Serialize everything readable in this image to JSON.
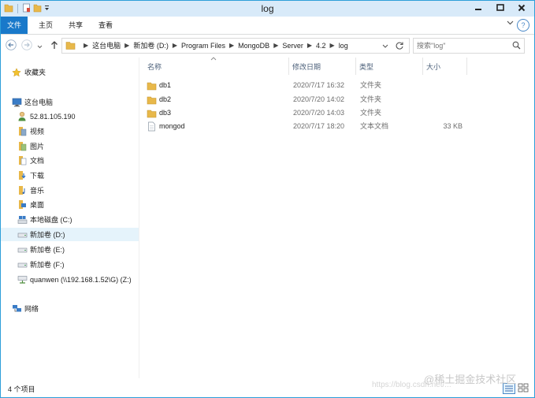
{
  "window": {
    "title": "log"
  },
  "quick_access": {
    "icons": [
      "folder-icon",
      "properties-icon",
      "new-folder-icon",
      "dropdown-icon"
    ]
  },
  "ribbon": {
    "tabs": [
      {
        "label": "文件",
        "active": true
      },
      {
        "label": "主页"
      },
      {
        "label": "共享"
      },
      {
        "label": "查看"
      }
    ],
    "help": "?"
  },
  "nav": {
    "back": "←",
    "forward": "→",
    "up": "↑"
  },
  "address": {
    "crumbs": [
      "这台电脑",
      "新加卷 (D:)",
      "Program Files",
      "MongoDB",
      "Server",
      "4.2",
      "log"
    ]
  },
  "search": {
    "placeholder": "搜索\"log\""
  },
  "navpane": {
    "items": [
      {
        "label": "收藏夹",
        "icon": "star-icon"
      },
      {
        "label": "这台电脑",
        "icon": "computer-icon"
      },
      {
        "label": "52.81.105.190",
        "icon": "user-icon"
      },
      {
        "label": "视频",
        "icon": "video-folder-icon"
      },
      {
        "label": "图片",
        "icon": "pictures-folder-icon"
      },
      {
        "label": "文档",
        "icon": "documents-folder-icon"
      },
      {
        "label": "下载",
        "icon": "downloads-folder-icon"
      },
      {
        "label": "音乐",
        "icon": "music-folder-icon"
      },
      {
        "label": "桌面",
        "icon": "desktop-folder-icon"
      },
      {
        "label": "本地磁盘 (C:)",
        "icon": "system-drive-icon"
      },
      {
        "label": "新加卷 (D:)",
        "icon": "drive-icon",
        "selected": true
      },
      {
        "label": "新加卷 (E:)",
        "icon": "drive-icon"
      },
      {
        "label": "新加卷 (F:)",
        "icon": "drive-icon"
      },
      {
        "label": "quanwen (\\\\192.168.1.52\\G) (Z:)",
        "icon": "network-drive-icon"
      },
      {
        "label": "网络",
        "icon": "network-icon"
      }
    ]
  },
  "columns": {
    "name": "名称",
    "date": "修改日期",
    "type": "类型",
    "size": "大小"
  },
  "files": [
    {
      "name": "db1",
      "date": "2020/7/17 16:32",
      "type": "文件夹",
      "size": "",
      "icon": "folder-icon"
    },
    {
      "name": "db2",
      "date": "2020/7/20 14:02",
      "type": "文件夹",
      "size": "",
      "icon": "folder-icon"
    },
    {
      "name": "db3",
      "date": "2020/7/20 14:03",
      "type": "文件夹",
      "size": "",
      "icon": "folder-icon"
    },
    {
      "name": "mongod",
      "date": "2020/7/17 18:20",
      "type": "文本文档",
      "size": "33 KB",
      "icon": "text-file-icon"
    }
  ],
  "status": {
    "item_count": "4 个项目"
  },
  "watermark": {
    "text": "@稀土掘金技术社区",
    "url": "https://blog.csdn.net/..."
  },
  "colors": {
    "accent": "#1979ca",
    "folder": "#e8b84a",
    "selection": "#e5f3fb"
  }
}
